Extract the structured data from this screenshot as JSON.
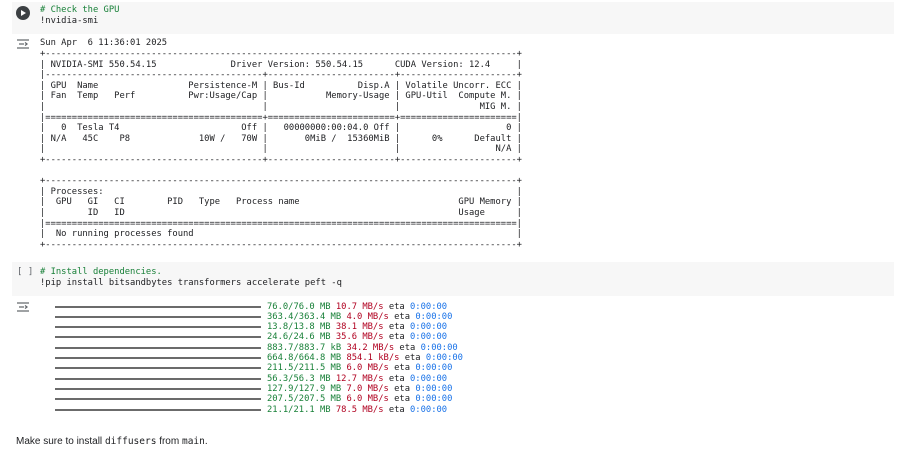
{
  "cell1": {
    "comment": "# Check the GPU",
    "command": "!nvidia-smi"
  },
  "output1": {
    "timestamp": "Sun Apr  6 11:36:01 2025",
    "smi_text": "+-----------------------------------------------------------------------------------------+\n| NVIDIA-SMI 550.54.15              Driver Version: 550.54.15      CUDA Version: 12.4     |\n|-----------------------------------------+------------------------+----------------------+\n| GPU  Name                 Persistence-M | Bus-Id          Disp.A | Volatile Uncorr. ECC |\n| Fan  Temp   Perf          Pwr:Usage/Cap |           Memory-Usage | GPU-Util  Compute M. |\n|                                         |                        |               MIG M. |\n|=========================================+========================+======================|\n|   0  Tesla T4                       Off |   00000000:00:04.0 Off |                    0 |\n| N/A   45C    P8             10W /   70W |       0MiB /  15360MiB |      0%      Default |\n|                                         |                        |                  N/A |\n+-----------------------------------------+------------------------+----------------------+\n\n+-----------------------------------------------------------------------------------------+\n| Processes:                                                                              |\n|  GPU   GI   CI        PID   Type   Process name                              GPU Memory |\n|        ID   ID                                                               Usage      |\n|=========================================================================================|\n|  No running processes found                                                             |\n+-----------------------------------------------------------------------------------------+"
  },
  "cell2": {
    "bracket": "[ ]",
    "comment": "# Install dependencies.",
    "command": "!pip install bitsandbytes transformers accelerate peft -q"
  },
  "progress": [
    {
      "size": "76.0/76.0 MB",
      "speed": "10.7 MB/s",
      "eta_label": "eta",
      "eta": "0:00:00"
    },
    {
      "size": "363.4/363.4 MB",
      "speed": "4.0 MB/s",
      "eta_label": "eta",
      "eta": "0:00:00"
    },
    {
      "size": "13.8/13.8 MB",
      "speed": "38.1 MB/s",
      "eta_label": "eta",
      "eta": "0:00:00"
    },
    {
      "size": "24.6/24.6 MB",
      "speed": "35.6 MB/s",
      "eta_label": "eta",
      "eta": "0:00:00"
    },
    {
      "size": "883.7/883.7 kB",
      "speed": "34.2 MB/s",
      "eta_label": "eta",
      "eta": "0:00:00"
    },
    {
      "size": "664.8/664.8 MB",
      "speed": "854.1 kB/s",
      "eta_label": "eta",
      "eta": "0:00:00"
    },
    {
      "size": "211.5/211.5 MB",
      "speed": "6.0 MB/s",
      "eta_label": "eta",
      "eta": "0:00:00"
    },
    {
      "size": "56.3/56.3 MB",
      "speed": "12.7 MB/s",
      "eta_label": "eta",
      "eta": "0:00:00"
    },
    {
      "size": "127.9/127.9 MB",
      "speed": "7.0 MB/s",
      "eta_label": "eta",
      "eta": "0:00:00"
    },
    {
      "size": "207.5/207.5 MB",
      "speed": "6.0 MB/s",
      "eta_label": "eta",
      "eta": "0:00:00"
    },
    {
      "size": "21.1/21.1 MB",
      "speed": "78.5 MB/s",
      "eta_label": "eta",
      "eta": "0:00:00"
    }
  ],
  "markdown": {
    "prefix": "Make sure to install ",
    "code1": "diffusers",
    "middle": " from ",
    "code2": "main",
    "suffix": "."
  }
}
